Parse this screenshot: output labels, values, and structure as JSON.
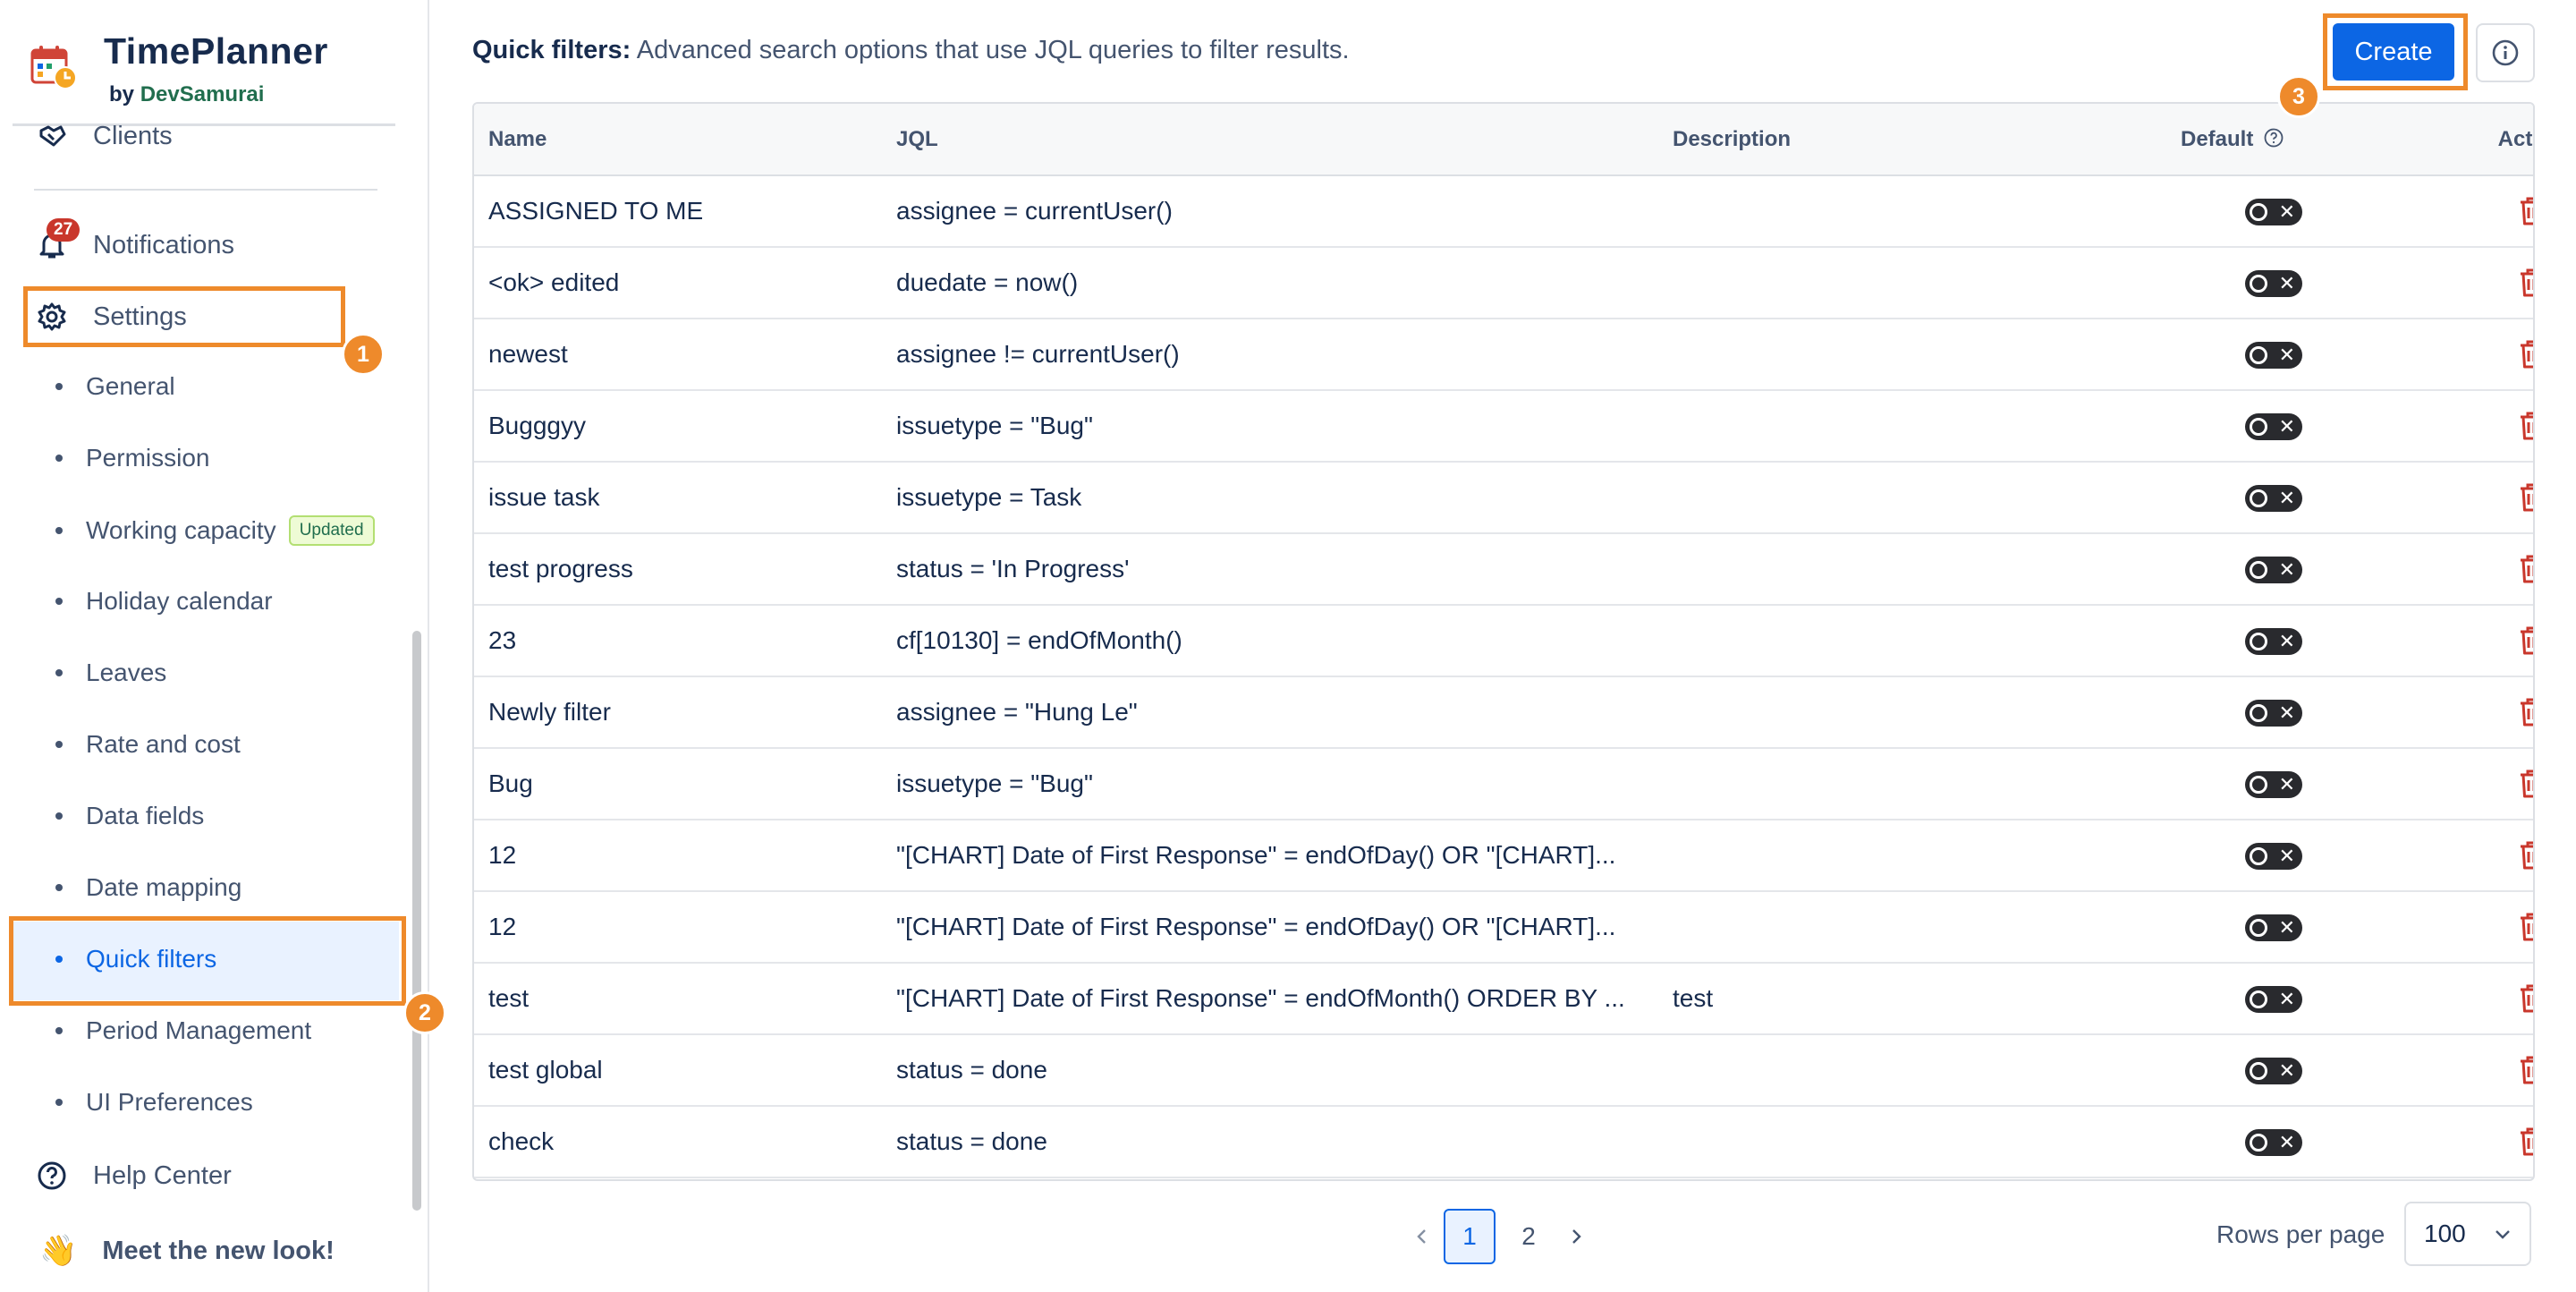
{
  "brand": {
    "name": "TimePlanner",
    "by": "by",
    "company": "DevSamurai"
  },
  "sidebar": {
    "clients_label": "Clients",
    "notifications_label": "Notifications",
    "notifications_count": "27",
    "settings_label": "Settings",
    "settings_items": [
      {
        "label": "General"
      },
      {
        "label": "Permission"
      },
      {
        "label": "Working capacity",
        "badge": "Updated"
      },
      {
        "label": "Holiday calendar"
      },
      {
        "label": "Leaves"
      },
      {
        "label": "Rate and cost"
      },
      {
        "label": "Data fields"
      },
      {
        "label": "Date mapping"
      },
      {
        "label": "Quick filters"
      },
      {
        "label": "Period Management"
      },
      {
        "label": "UI Preferences"
      }
    ],
    "help_label": "Help Center",
    "meet_label": "Meet the new look!"
  },
  "annotations": [
    "1",
    "2",
    "3"
  ],
  "header": {
    "title_bold": "Quick filters:",
    "title_rest": " Advanced search options that use JQL queries to filter results.",
    "create_label": "Create"
  },
  "table": {
    "columns": [
      "Name",
      "JQL",
      "Description",
      "Default",
      "Action"
    ],
    "rows": [
      {
        "name": "ASSIGNED TO ME",
        "jql": "assignee = currentUser()",
        "description": ""
      },
      {
        "name": "<ok> edited",
        "jql": "duedate = now()",
        "description": ""
      },
      {
        "name": "newest",
        "jql": "assignee != currentUser()",
        "description": ""
      },
      {
        "name": "Bugggyy",
        "jql": "issuetype = \"Bug\"",
        "description": ""
      },
      {
        "name": "issue task",
        "jql": "issuetype = Task",
        "description": ""
      },
      {
        "name": "test progress",
        "jql": "status = 'In Progress'",
        "description": ""
      },
      {
        "name": "23",
        "jql": "cf[10130] = endOfMonth()",
        "description": ""
      },
      {
        "name": "Newly filter",
        "jql": "assignee = \"Hung Le\"",
        "description": ""
      },
      {
        "name": "Bug",
        "jql": "issuetype = \"Bug\"",
        "description": ""
      },
      {
        "name": "12",
        "jql": "\"[CHART] Date of First Response\" = endOfDay() OR \"[CHART]...",
        "description": ""
      },
      {
        "name": "12",
        "jql": "\"[CHART] Date of First Response\" = endOfDay() OR \"[CHART]...",
        "description": ""
      },
      {
        "name": "test",
        "jql": "\"[CHART] Date of First Response\" = endOfMonth() ORDER BY ...",
        "description": "test"
      },
      {
        "name": "test global",
        "jql": "status = done",
        "description": ""
      },
      {
        "name": "check",
        "jql": "status = done",
        "description": ""
      }
    ]
  },
  "pagination": {
    "pages": [
      "1",
      "2"
    ],
    "current": "1",
    "rows_label": "Rows per page",
    "rows_value": "100"
  },
  "colors": {
    "accent": "#0c66e4",
    "annotation": "#ee8a2b",
    "delete": "#c9372c",
    "badge_green": "#216e4e"
  }
}
